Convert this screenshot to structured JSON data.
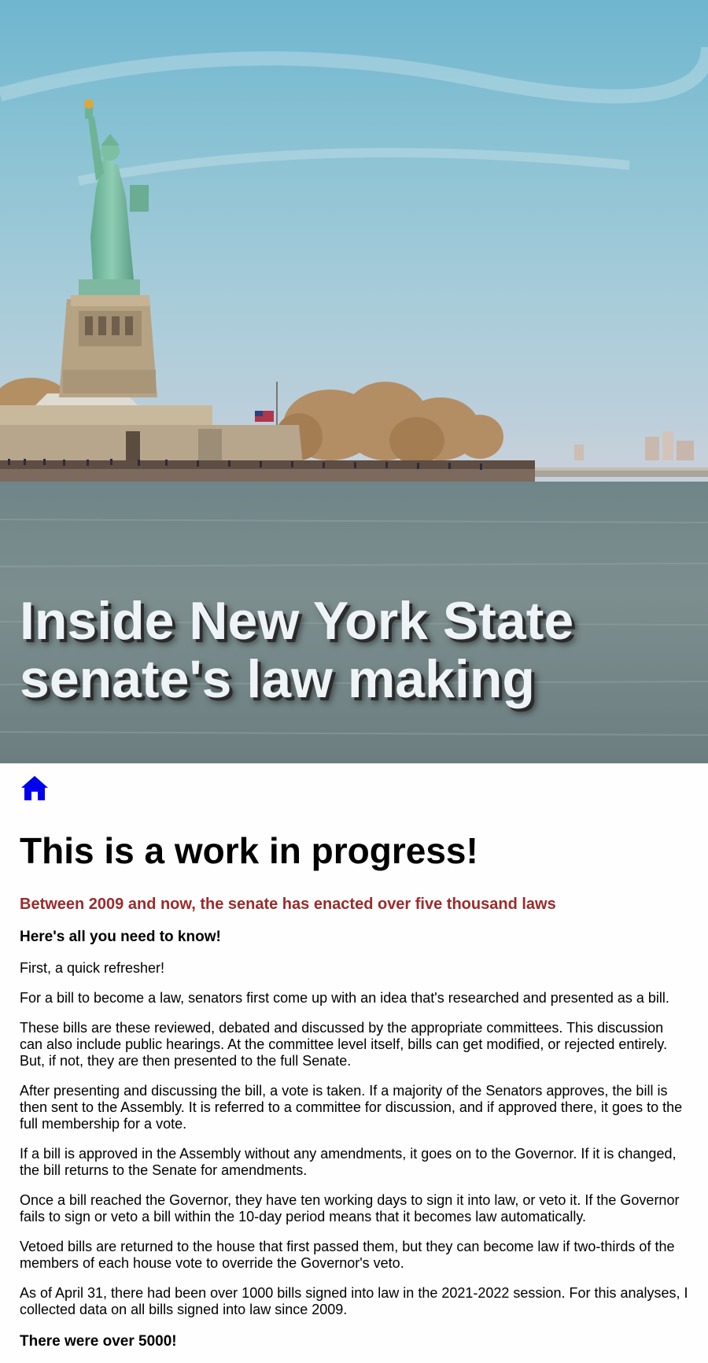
{
  "hero": {
    "title_line1": "Inside New York State",
    "title_line2": "senate's law making",
    "image": "statue-of-liberty-photo"
  },
  "nav": {
    "home_icon": "home-icon"
  },
  "main": {
    "heading": "This is a work in progress!",
    "subheading": "Between 2009 and now, the senate has enacted over five thousand laws",
    "intro": "Here's all you need to know!",
    "paragraphs": [
      "First, a quick refresher!",
      "For a bill to become a law, senators first come up with an idea that's researched and presented as a bill.",
      "These bills are these reviewed, debated and discussed by the appropriate committees. This discussion can also include public hearings. At the committee level itself, bills can get modified, or rejected entirely. But, if not, they are then presented to the full Senate.",
      "After presenting and discussing the bill, a vote is taken. If a majority of the Senators approves, the bill is then sent to the Assembly. It is referred to a committee for discussion, and if approved there, it goes to the full membership for a vote.",
      "If a bill is approved in the Assembly without any amendments, it goes on to the Governor. If it is changed, the bill returns to the Senate for amendments.",
      "Once a bill reached the Governor, they have ten working days to sign it into law, or veto it. If the Governor fails to sign or veto a bill within the 10-day period means that it becomes law automatically.",
      "Vetoed bills are returned to the house that first passed them, but they can become law if two-thirds of the members of each house vote to override the Governor's veto.",
      "As of April 31, there had been over 1000 bills signed into law in the 2021-2022 session. For this analyses, I collected data on all bills signed into law since 2009."
    ],
    "closing": "There were over 5000!"
  },
  "colors": {
    "subheading": "#9b2b2b",
    "home_icon": "#0000ee"
  }
}
